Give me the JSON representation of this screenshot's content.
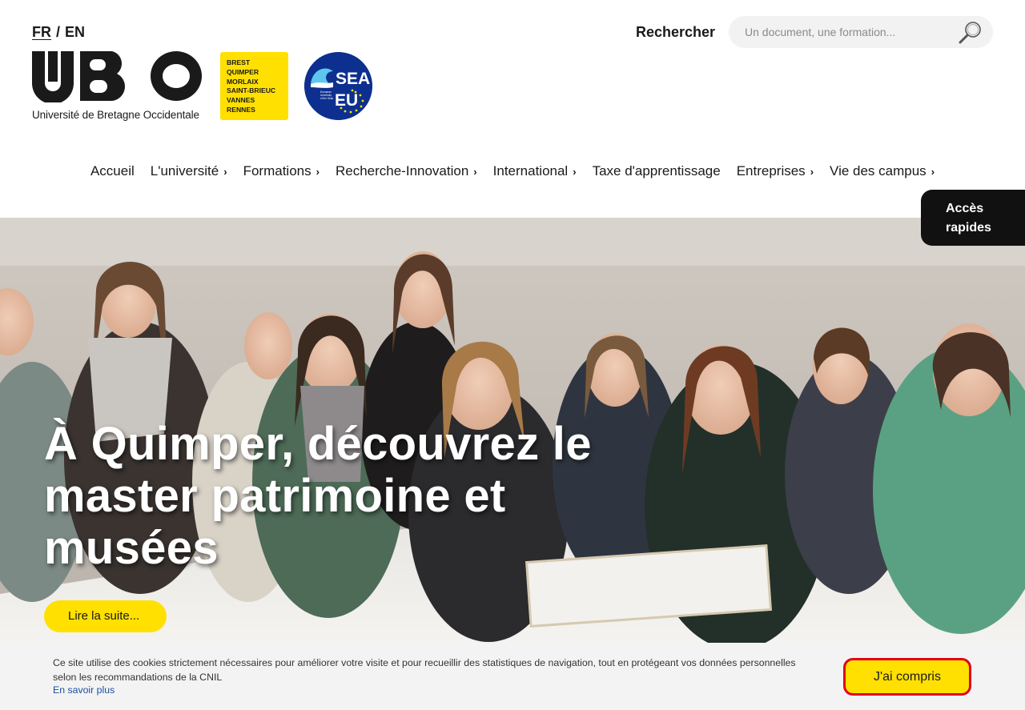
{
  "header": {
    "lang": {
      "fr": "FR",
      "separator": "/",
      "en": "EN"
    },
    "logo": {
      "wordmark": "UBO",
      "subtitle": "Université de Bretagne Occidentale"
    },
    "cities": [
      "BREST",
      "QUIMPER",
      "MORLAIX",
      "SAINT-BRIEUC",
      "VANNES",
      "RENNES"
    ],
    "sea_logo": {
      "line1": "SEA",
      "line2": "EU",
      "tagline": "European University of the Seas"
    },
    "search": {
      "label": "Rechercher",
      "placeholder": "Un document, une formation..."
    }
  },
  "nav": {
    "items": [
      {
        "label": "Accueil",
        "has_submenu": false
      },
      {
        "label": "L'université",
        "has_submenu": true
      },
      {
        "label": "Formations",
        "has_submenu": true
      },
      {
        "label": "Recherche-Innovation",
        "has_submenu": true
      },
      {
        "label": "International",
        "has_submenu": true
      },
      {
        "label": "Taxe d'apprentissage",
        "has_submenu": false
      },
      {
        "label": "Entreprises",
        "has_submenu": true
      },
      {
        "label": "Vie des campus",
        "has_submenu": true
      }
    ],
    "chevron": "›"
  },
  "quick_access": {
    "line1": "Accès",
    "line2": "rapides"
  },
  "hero": {
    "title": "À Quimper, découvrez le master patrimoine et musées",
    "button": "Lire la suite..."
  },
  "cookie": {
    "text": "Ce site utilise des cookies strictement nécessaires pour améliorer votre visite et pour recueillir des statistiques de navigation, tout en protégeant vos données personnelles selon les recommandations de la CNIL",
    "link": "En savoir plus",
    "button": "J'ai compris"
  },
  "colors": {
    "accent_yellow": "#ffe000",
    "dark": "#111111",
    "sea_blue": "#0d2f8f",
    "focus_red": "#e0001a"
  }
}
